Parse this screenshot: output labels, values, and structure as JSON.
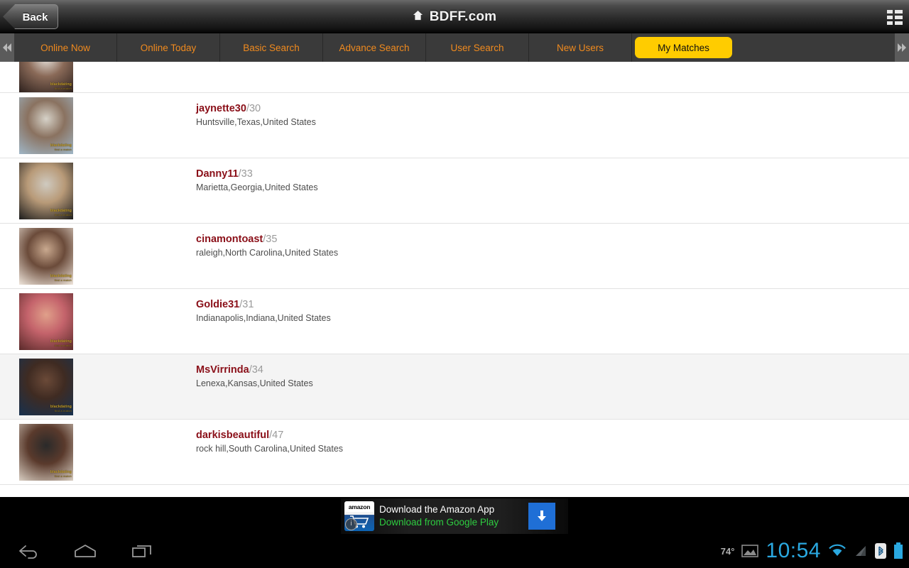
{
  "titlebar": {
    "back_label": "Back",
    "app_title": "BDFF.com",
    "home_icon": "home-icon",
    "menu_icon": "grid-menu-icon"
  },
  "tabbar": {
    "scroll_left_icon": "double-chevron-left-icon",
    "scroll_right_icon": "double-chevron-right-icon",
    "active_tab": "My Matches",
    "tabs": [
      {
        "label": "Online Now",
        "active": false
      },
      {
        "label": "Online Today",
        "active": false
      },
      {
        "label": "Basic Search",
        "active": false
      },
      {
        "label": "Advance Search",
        "active": false
      },
      {
        "label": "User Search",
        "active": false
      },
      {
        "label": "New Users",
        "active": false
      },
      {
        "label": "My Matches",
        "active": true
      }
    ],
    "colors": {
      "tab_text": "#f08a1e",
      "active_bg": "#ffcc00",
      "active_text": "#101010",
      "bar_bg": "#3a3a3a"
    }
  },
  "list": {
    "watermark": "blackdating",
    "watermark_sub": "find a match",
    "rows": [
      {
        "username": "",
        "age": "",
        "location": "",
        "partial": true,
        "highlight": false,
        "thumb_colors": [
          "#2b1f1c",
          "#8a6a58",
          "#e8e4de"
        ]
      },
      {
        "username": "jaynette30",
        "age": "/30",
        "location": "Huntsville,Texas,United States",
        "partial": false,
        "highlight": false,
        "thumb_colors": [
          "#9fb6c6",
          "#8a7260",
          "#d6d2c8"
        ]
      },
      {
        "username": "Danny11",
        "age": "/33",
        "location": "Marietta,Georgia,United States",
        "partial": false,
        "highlight": false,
        "thumb_colors": [
          "#1c1c1c",
          "#b89a78",
          "#cfcac0"
        ]
      },
      {
        "username": "cinamontoast",
        "age": "/35",
        "location": "raleigh,North Carolina,United States",
        "partial": false,
        "highlight": false,
        "thumb_colors": [
          "#efe6dc",
          "#6b4b3a",
          "#c9a98f"
        ]
      },
      {
        "username": "Goldie31",
        "age": "/31",
        "location": "Indianapolis,Indiana,United States",
        "partial": false,
        "highlight": false,
        "thumb_colors": [
          "#5a2a2a",
          "#c4636b",
          "#e0a08a"
        ]
      },
      {
        "username": "MsVirrinda",
        "age": "/34",
        "location": "Lenexa,Kansas,United States",
        "partial": false,
        "highlight": true,
        "thumb_colors": [
          "#17314f",
          "#3f2b22",
          "#6b4a38"
        ]
      },
      {
        "username": "darkisbeautiful",
        "age": "/47",
        "location": "rock hill,South Carolina,United States",
        "partial": false,
        "highlight": false,
        "thumb_colors": [
          "#d8cec2",
          "#5a3a2c",
          "#2a2a2a"
        ]
      }
    ]
  },
  "ad": {
    "icon_label": "amazon",
    "line1": "Download the Amazon App",
    "line2": "Download from Google Play",
    "info_label": "i",
    "cta_icon": "download-arrow-icon"
  },
  "navbar": {
    "back_icon": "nav-back-icon",
    "home_icon": "nav-home-icon",
    "recents_icon": "nav-recents-icon",
    "temperature": "74°",
    "photo_icon": "photo-icon",
    "clock": "10:54",
    "wifi_icon": "wifi-icon",
    "signal_icon": "cell-signal-icon",
    "bluetooth_icon": "bluetooth-icon",
    "battery_icon": "battery-icon",
    "clock_color": "#2aa8e0"
  }
}
